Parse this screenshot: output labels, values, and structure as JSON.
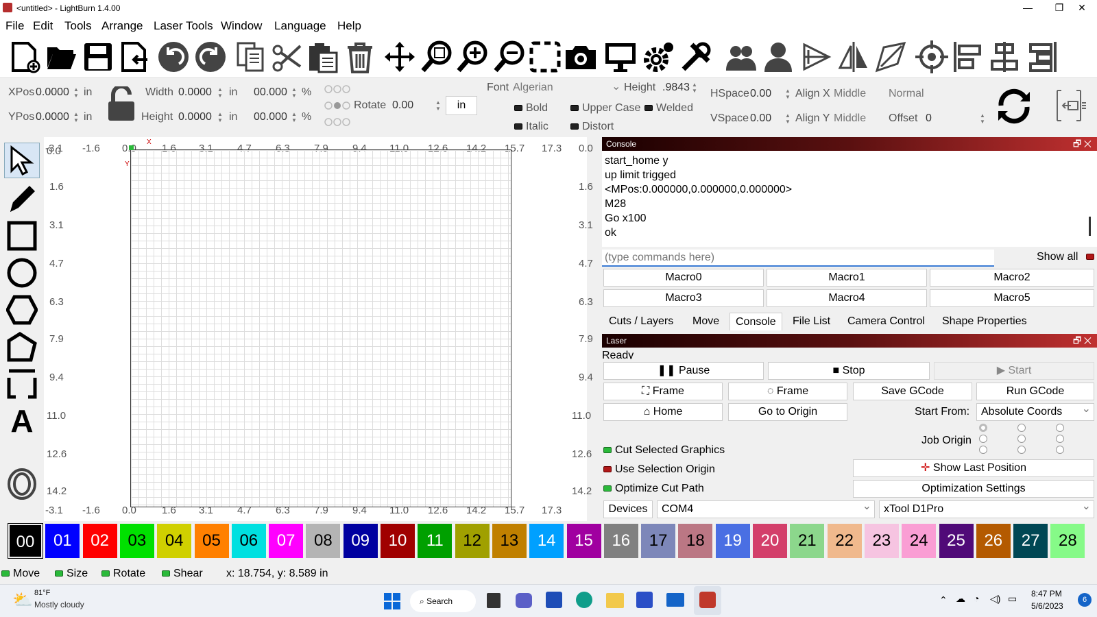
{
  "window": {
    "title": "<untitled> - LightBurn 1.4.00",
    "minimize": "—",
    "maximize": "❐",
    "close": "✕"
  },
  "menu": [
    "File",
    "Edit",
    "Tools",
    "Arrange",
    "Laser Tools",
    "Window",
    "Language",
    "Help"
  ],
  "toolbar": [
    "new-file-icon",
    "open-folder-icon",
    "save-icon",
    "import-icon",
    "undo-icon",
    "redo-icon",
    "copy-icon",
    "cut-icon",
    "paste-icon",
    "delete-icon",
    "move-icon",
    "zoom-selection-icon",
    "zoom-in-icon",
    "zoom-out-icon",
    "frame-selection-icon",
    "camera-icon",
    "monitor-icon",
    "settings-icon",
    "tools-icon",
    "group-icon",
    "user-icon",
    "trace-icon",
    "mirror-icon",
    "edit-nodes-icon",
    "target-icon",
    "align-left-icon",
    "align-center-icon",
    "distribute-icon"
  ],
  "props": {
    "xpos_label": "XPos",
    "xpos": "0.0000",
    "ypos_label": "YPos",
    "ypos": "0.0000",
    "unit": "in",
    "width_label": "Width",
    "width": "0.0000",
    "height_label": "Height",
    "height": "0.0000",
    "scale_w": "00.000",
    "scale_h": "00.000",
    "pct": "%",
    "rotate_label": "Rotate",
    "rotate": "0.00",
    "unit_button": "in",
    "font_label": "Font",
    "font": "Algerian",
    "fheight_label": "Height",
    "fheight": ".9843",
    "hspace_label": "HSpace",
    "hspace": "0.00",
    "vspace_label": "VSpace",
    "vspace": "0.00",
    "alignx_label": "Align X",
    "alignx": "Middle",
    "aligny_label": "Align Y",
    "aligny": "Middle",
    "style": "Normal",
    "offset_label": "Offset",
    "offset": "0",
    "bold": "Bold",
    "italic": "Italic",
    "upper": "Upper Case",
    "welded": "Welded",
    "distort": "Distort"
  },
  "ruler": {
    "top": [
      "-3.1",
      "-1.6",
      "0.0",
      "1.6",
      "3.1",
      "4.7",
      "6.3",
      "7.9",
      "9.4",
      "11.0",
      "12.6",
      "14.2",
      "15.7",
      "17.3"
    ],
    "left": [
      "0.0",
      "1.6",
      "3.1",
      "4.7",
      "6.3",
      "7.9",
      "9.4",
      "11.0",
      "12.6",
      "14.2"
    ],
    "right": [
      "0.0",
      "1.6",
      "3.1",
      "4.7",
      "6.3",
      "7.9",
      "9.4",
      "11.0",
      "12.6",
      "14.2"
    ],
    "x": "X",
    "y": "Y"
  },
  "console": {
    "title": "Console",
    "lines": [
      "start_home y",
      "up limit trigged",
      "<MPos:0.000000,0.000000,0.000000>",
      "M28",
      "Go x100",
      "ok"
    ],
    "placeholder": "(type commands here)",
    "show_all": "Show all",
    "macros": [
      "Macro0",
      "Macro1",
      "Macro2",
      "Macro3",
      "Macro4",
      "Macro5"
    ]
  },
  "tabs": [
    "Cuts / Layers",
    "Move",
    "Console",
    "File List",
    "Camera Control",
    "Shape Properties"
  ],
  "laser": {
    "title": "Laser",
    "status": "Ready",
    "pause": "Pause",
    "stop": "Stop",
    "start": "Start",
    "frame1": "Frame",
    "frame2": "Frame",
    "save_gcode": "Save GCode",
    "run_gcode": "Run GCode",
    "home": "Home",
    "go_origin": "Go to Origin",
    "start_from_label": "Start From:",
    "start_from": "Absolute Coords",
    "job_origin": "Job Origin",
    "cut_selected": "Cut Selected Graphics",
    "use_sel_origin": "Use Selection Origin",
    "optimize": "Optimize Cut Path",
    "show_last": "Show Last Position",
    "opt_settings": "Optimization Settings",
    "devices": "Devices",
    "port": "COM4",
    "device": "xTool D1Pro"
  },
  "palette": [
    {
      "n": "00",
      "c": "#000000",
      "t": "#ffffff"
    },
    {
      "n": "01",
      "c": "#0000ff",
      "t": "#ffffff"
    },
    {
      "n": "02",
      "c": "#ff0000",
      "t": "#ffffff"
    },
    {
      "n": "03",
      "c": "#00e000",
      "t": "#000000"
    },
    {
      "n": "04",
      "c": "#d0d000",
      "t": "#000000"
    },
    {
      "n": "05",
      "c": "#ff8000",
      "t": "#000000"
    },
    {
      "n": "06",
      "c": "#00e0e0",
      "t": "#000000"
    },
    {
      "n": "07",
      "c": "#ff00ff",
      "t": "#ffffff"
    },
    {
      "n": "08",
      "c": "#b4b4b4",
      "t": "#000000"
    },
    {
      "n": "09",
      "c": "#0000a0",
      "t": "#ffffff"
    },
    {
      "n": "10",
      "c": "#a00000",
      "t": "#ffffff"
    },
    {
      "n": "11",
      "c": "#00a000",
      "t": "#ffffff"
    },
    {
      "n": "12",
      "c": "#a0a000",
      "t": "#000000"
    },
    {
      "n": "13",
      "c": "#c08000",
      "t": "#000000"
    },
    {
      "n": "14",
      "c": "#00a0ff",
      "t": "#ffffff"
    },
    {
      "n": "15",
      "c": "#a000a0",
      "t": "#ffffff"
    },
    {
      "n": "16",
      "c": "#808080",
      "t": "#ffffff"
    },
    {
      "n": "17",
      "c": "#7d87b9",
      "t": "#000000"
    },
    {
      "n": "18",
      "c": "#bb7784",
      "t": "#000000"
    },
    {
      "n": "19",
      "c": "#4a6fe3",
      "t": "#ffffff"
    },
    {
      "n": "20",
      "c": "#d33f6a",
      "t": "#ffffff"
    },
    {
      "n": "21",
      "c": "#8cd78c",
      "t": "#000000"
    },
    {
      "n": "22",
      "c": "#f0b98d",
      "t": "#000000"
    },
    {
      "n": "23",
      "c": "#f6c4e1",
      "t": "#000000"
    },
    {
      "n": "24",
      "c": "#fa9ed4",
      "t": "#000000"
    },
    {
      "n": "25",
      "c": "#500a78",
      "t": "#ffffff"
    },
    {
      "n": "26",
      "c": "#b45a00",
      "t": "#ffffff"
    },
    {
      "n": "27",
      "c": "#004754",
      "t": "#ffffff"
    },
    {
      "n": "28",
      "c": "#86fa88",
      "t": "#000000"
    }
  ],
  "status": {
    "move": "Move",
    "size": "Size",
    "rotate": "Rotate",
    "shear": "Shear",
    "coords": "x: 18.754, y: 8.589 in"
  },
  "taskbar": {
    "temp": "81°F",
    "weather": "Mostly cloudy",
    "search": "Search",
    "time": "8:47 PM",
    "date": "5/6/2023",
    "badge": "6"
  }
}
